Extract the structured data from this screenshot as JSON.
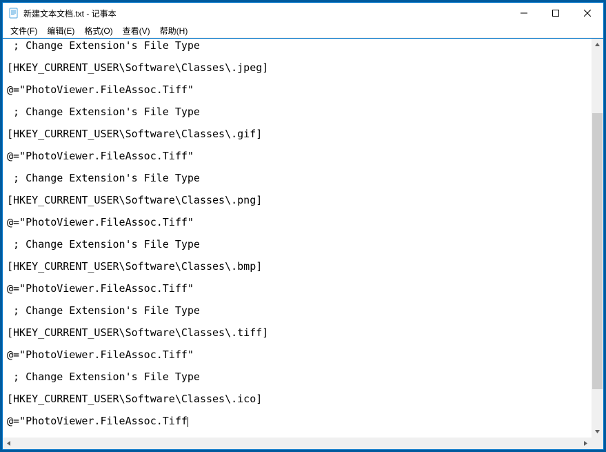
{
  "window": {
    "title": "新建文本文档.txt - 记事本"
  },
  "menu": {
    "file": "文件(F)",
    "edit": "编辑(E)",
    "format": "格式(O)",
    "view": "查看(V)",
    "help": "帮助(H)"
  },
  "editor": {
    "lines": [
      " ; Change Extension's File Type",
      "[HKEY_CURRENT_USER\\Software\\Classes\\.jpeg]",
      "@=\"PhotoViewer.FileAssoc.Tiff\"",
      " ; Change Extension's File Type",
      "[HKEY_CURRENT_USER\\Software\\Classes\\.gif]",
      "@=\"PhotoViewer.FileAssoc.Tiff\"",
      " ; Change Extension's File Type",
      "[HKEY_CURRENT_USER\\Software\\Classes\\.png]",
      "@=\"PhotoViewer.FileAssoc.Tiff\"",
      " ; Change Extension's File Type",
      "[HKEY_CURRENT_USER\\Software\\Classes\\.bmp]",
      "@=\"PhotoViewer.FileAssoc.Tiff\"",
      " ; Change Extension's File Type",
      "[HKEY_CURRENT_USER\\Software\\Classes\\.tiff]",
      "@=\"PhotoViewer.FileAssoc.Tiff\"",
      " ; Change Extension's File Type",
      "[HKEY_CURRENT_USER\\Software\\Classes\\.ico]",
      "@=\"PhotoViewer.FileAssoc.Tiff"
    ],
    "caret_on_last": true
  }
}
